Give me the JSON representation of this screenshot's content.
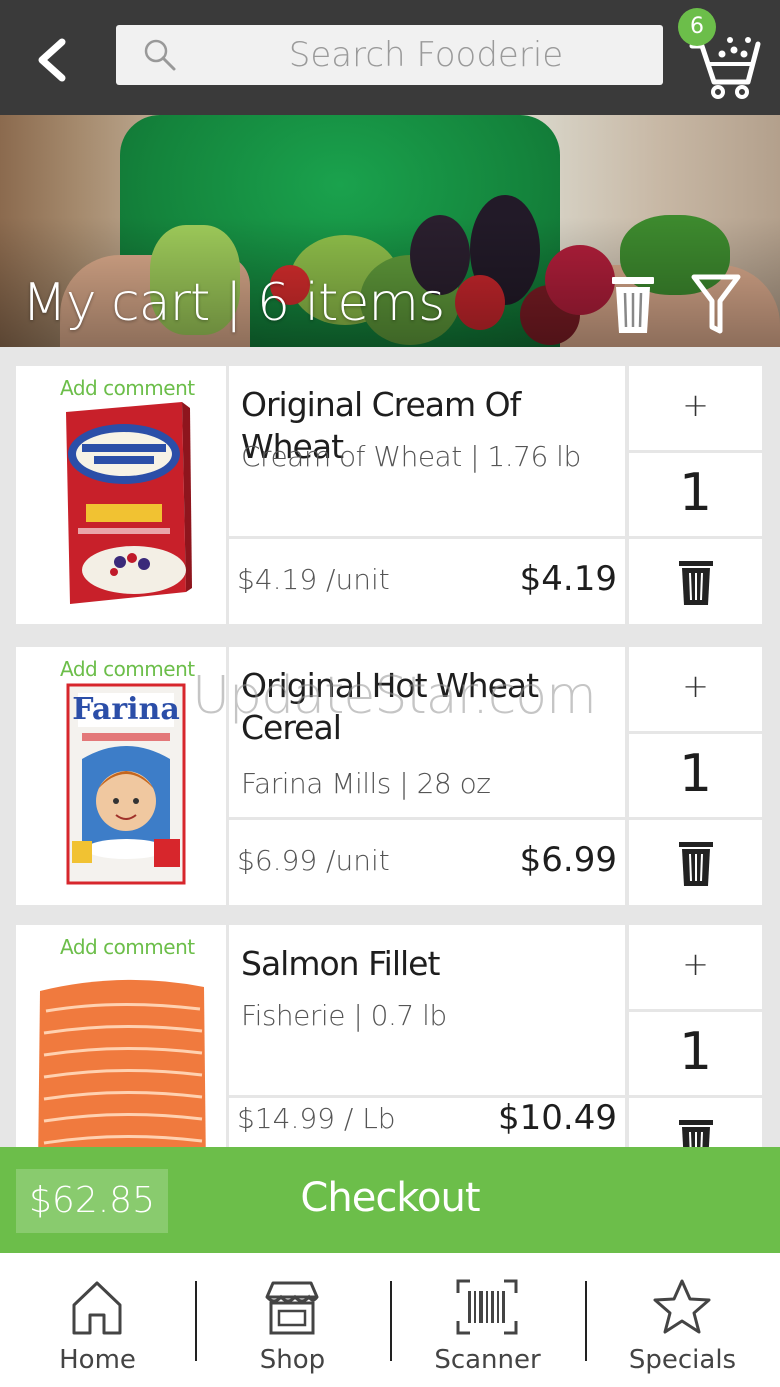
{
  "header": {
    "search_placeholder": "Search Fooderie",
    "cart_count": "6"
  },
  "banner": {
    "title": "My cart | 6 items"
  },
  "items": [
    {
      "add_comment": "Add comment",
      "name": "Original Cream Of Wheat",
      "detail": "Cream of Wheat | 1.76 lb",
      "unit_price": "$4.19 /unit",
      "total": "$4.19",
      "plus": "+",
      "quantity": "1"
    },
    {
      "add_comment": "Add comment",
      "name": "Original Hot Wheat Cereal",
      "detail": "Farina Mills | 28 oz",
      "unit_price": "$6.99 /unit",
      "total": "$6.99",
      "plus": "+",
      "quantity": "1"
    },
    {
      "add_comment": "Add comment",
      "name": "Salmon Fillet",
      "detail": "Fisherie | 0.7 lb",
      "unit_price": "$14.99 / Lb",
      "total": "$10.49",
      "plus": "+",
      "quantity": "1"
    }
  ],
  "watermark": "UpdateStar.com",
  "checkout": {
    "total": "$62.85",
    "label": "Checkout"
  },
  "nav": {
    "home": "Home",
    "shop": "Shop",
    "scanner": "Scanner",
    "specials": "Specials"
  },
  "colors": {
    "accent_green": "#6cbe4a",
    "top_bar": "#3a3a3a"
  }
}
